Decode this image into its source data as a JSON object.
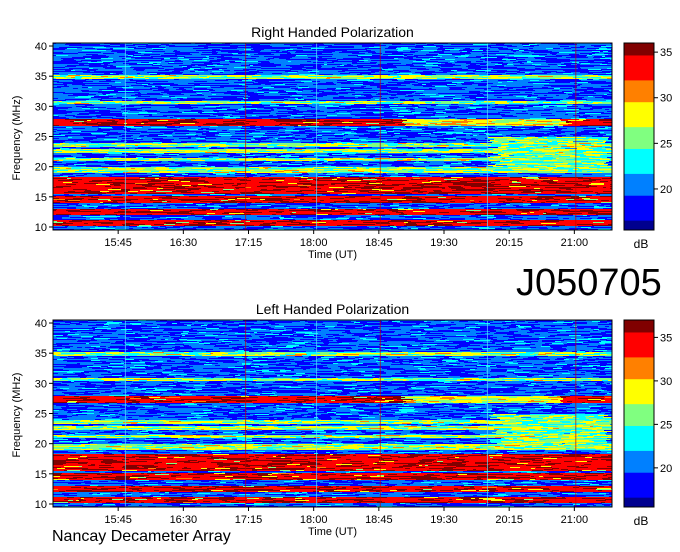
{
  "observation_id": "J050705",
  "footer_label": "Nancay Decameter Array",
  "colors": {
    "colormap": [
      "#00008f",
      "#0000ff",
      "#0080ff",
      "#00ffff",
      "#80ff80",
      "#ffff00",
      "#ff8000",
      "#ff0000",
      "#800000"
    ]
  },
  "chart_data": [
    {
      "type": "heatmap",
      "title": "Right Handed Polarization",
      "xlabel": "Time (UT)",
      "ylabel": "Frequency (MHz)",
      "x_ticks": [
        "15:45",
        "16:30",
        "17:15",
        "18:00",
        "18:45",
        "19:30",
        "20:15",
        "21:00"
      ],
      "x_tick_minutes": [
        945,
        990,
        1035,
        1080,
        1125,
        1170,
        1215,
        1260
      ],
      "xlim_minutes": [
        900,
        1286
      ],
      "y_ticks": [
        10,
        15,
        20,
        25,
        30,
        35,
        40
      ],
      "ylim": [
        9.5,
        40.5
      ],
      "colorbar": {
        "label": "dB",
        "ticks": [
          20,
          25,
          30,
          35
        ],
        "range": [
          15.5,
          36
        ]
      },
      "strong_bands_mhz": [
        [
          10.2,
          11.2
        ],
        [
          12.0,
          13.0
        ],
        [
          14.0,
          15.2
        ],
        [
          15.6,
          18.3
        ],
        [
          26.8,
          28.0
        ]
      ],
      "moderate_bands_mhz": [
        [
          19.0,
          20.0
        ],
        [
          21.0,
          21.6
        ],
        [
          22.4,
          23.0
        ],
        [
          23.4,
          24.0
        ],
        [
          30.5,
          31.0
        ],
        [
          34.6,
          35.2
        ]
      ]
    },
    {
      "type": "heatmap",
      "title": "Left Handed Polarization",
      "xlabel": "Time (UT)",
      "ylabel": "Frequency (MHz)",
      "x_ticks": [
        "15:45",
        "16:30",
        "17:15",
        "18:00",
        "18:45",
        "19:30",
        "20:15",
        "21:00"
      ],
      "x_tick_minutes": [
        945,
        990,
        1035,
        1080,
        1125,
        1170,
        1215,
        1260
      ],
      "xlim_minutes": [
        900,
        1286
      ],
      "y_ticks": [
        10,
        15,
        20,
        25,
        30,
        35,
        40
      ],
      "ylim": [
        9.5,
        40.5
      ],
      "colorbar": {
        "label": "dB",
        "ticks": [
          20,
          25,
          30,
          35
        ],
        "range": [
          15.5,
          37
        ]
      },
      "strong_bands_mhz": [
        [
          10.2,
          11.2
        ],
        [
          12.0,
          13.0
        ],
        [
          14.0,
          15.2
        ],
        [
          15.6,
          18.3
        ],
        [
          26.8,
          28.0
        ]
      ],
      "moderate_bands_mhz": [
        [
          19.0,
          20.0
        ],
        [
          21.0,
          21.6
        ],
        [
          22.4,
          23.0
        ],
        [
          23.4,
          24.0
        ],
        [
          30.5,
          31.0
        ],
        [
          34.6,
          35.2
        ]
      ]
    }
  ]
}
